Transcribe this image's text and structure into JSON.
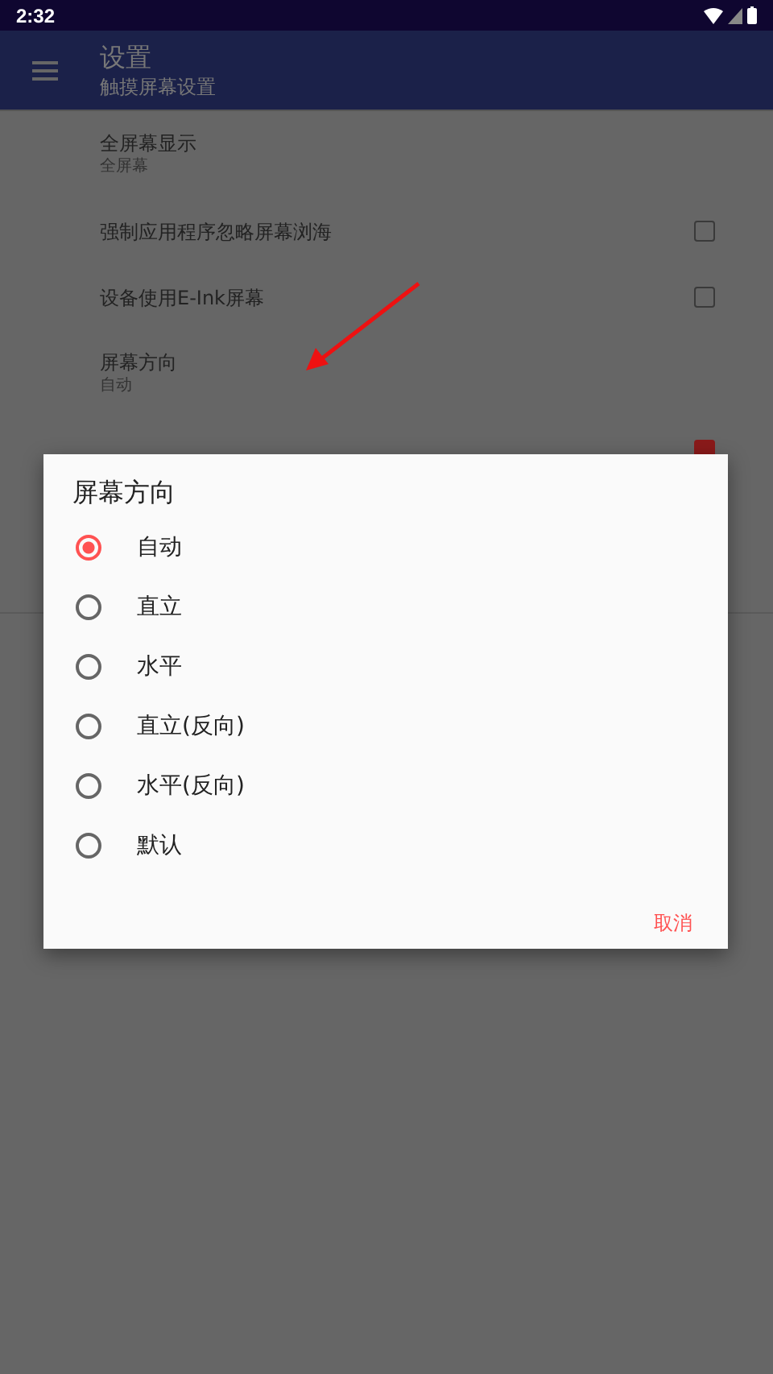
{
  "status_bar": {
    "time": "2:32"
  },
  "app_bar": {
    "title": "设置",
    "subtitle": "触摸屏幕设置"
  },
  "settings": [
    {
      "kind": "text",
      "title": "全屏幕显示",
      "summary": "全屏幕"
    },
    {
      "kind": "checkbox",
      "title": "强制应用程序忽略屏幕浏海",
      "checked": false
    },
    {
      "kind": "checkbox",
      "title": "设备使用E-Ink屏幕",
      "checked": false
    },
    {
      "kind": "text",
      "title": "屏幕方向",
      "summary": "自动"
    },
    {
      "kind": "checkbox",
      "checked": true
    }
  ],
  "dialog": {
    "title": "屏幕方向",
    "options": [
      {
        "label": "自动",
        "selected": true
      },
      {
        "label": "直立",
        "selected": false
      },
      {
        "label": "水平",
        "selected": false
      },
      {
        "label": "直立(反向)",
        "selected": false
      },
      {
        "label": "水平(反向)",
        "selected": false
      },
      {
        "label": "默认",
        "selected": false
      }
    ],
    "buttons": [
      "取消"
    ]
  }
}
